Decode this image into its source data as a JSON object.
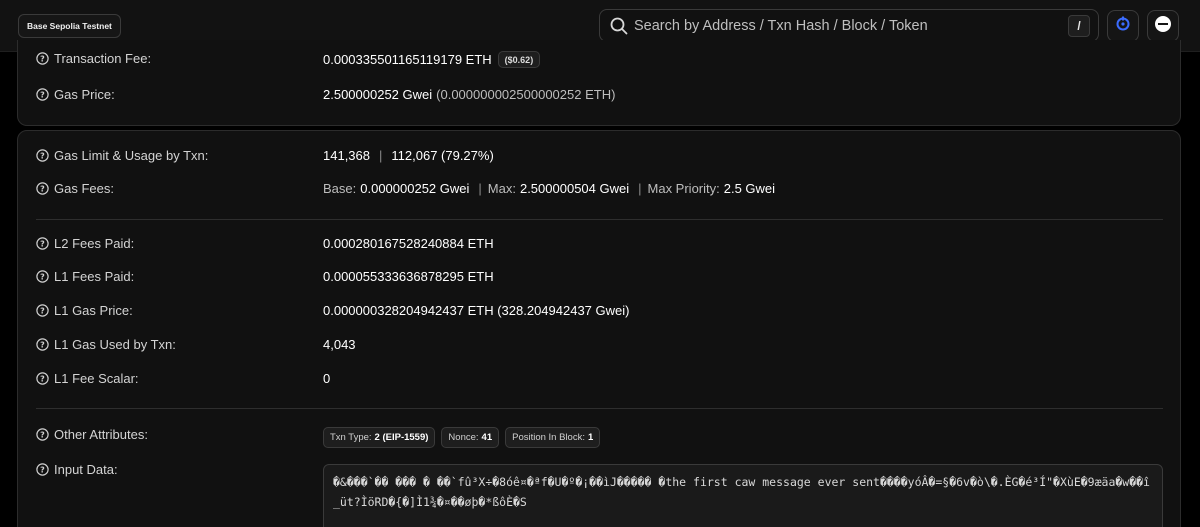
{
  "header": {
    "network_badge": "Base Sepolia Testnet",
    "search_placeholder": "Search by Address / Txn Hash / Block / Token",
    "search_shortcut": "/"
  },
  "fees_top": {
    "transaction_fee": {
      "label": "Transaction Fee:",
      "value": "0.000335501165119179 ETH",
      "usd": "($0.62)"
    },
    "gas_price": {
      "label": "Gas Price:",
      "value": "2.500000252 Gwei",
      "value_eth": "(0.000000002500000252 ETH)"
    }
  },
  "gas": {
    "limit_usage": {
      "label": "Gas Limit & Usage by Txn:",
      "limit": "141,368",
      "separator": "|",
      "usage": "112,067 (79.27%)"
    },
    "gas_fees": {
      "label": "Gas Fees:",
      "base_label": "Base:",
      "base_value": "0.000000252 Gwei",
      "max_label": "Max:",
      "max_value": "2.500000504 Gwei",
      "priority_label": "Max Priority:",
      "priority_value": "2.5 Gwei",
      "separator": "|"
    }
  },
  "l1l2": {
    "l2_fees": {
      "label": "L2 Fees Paid:",
      "value": "0.000280167528240884 ETH"
    },
    "l1_fees": {
      "label": "L1 Fees Paid:",
      "value": "0.000055333636878295 ETH"
    },
    "l1_gas_price": {
      "label": "L1 Gas Price:",
      "value": "0.000000328204942437 ETH (328.204942437 Gwei)"
    },
    "l1_gas_used": {
      "label": "L1 Gas Used by Txn:",
      "value": "4,043"
    },
    "l1_fee_scalar": {
      "label": "L1 Fee Scalar:",
      "value": "0"
    }
  },
  "attributes": {
    "label": "Other Attributes:",
    "txn_type_label": "Txn Type:",
    "txn_type_value": "2 (EIP-1559)",
    "nonce_label": "Nonce:",
    "nonce_value": "41",
    "position_label": "Position In Block:",
    "position_value": "1"
  },
  "input_data": {
    "label": "Input Data:",
    "value": "�&���`�� ��� � ��`fû³X÷�8óê¤�ªf�U�º�¡��ìJ����� �the first caw message ever sent����yóÂ�=§�6v�ò\\�.ÈG�é³Í\"�XùE�9æäa�w��î_üt?ÌöRD�{�]Ì1¾�¤��øþ�*ßôÈ�S"
  }
}
